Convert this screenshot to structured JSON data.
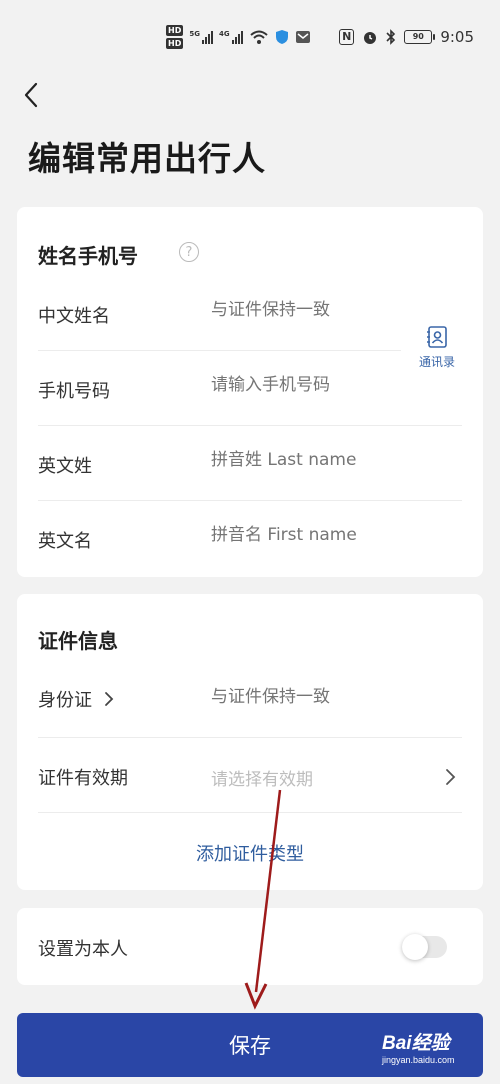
{
  "status_bar": {
    "hd1": "HD",
    "hd2": "HD",
    "sig1_label": "5G",
    "sig2_label": "4G",
    "nfc": "N",
    "battery": "90",
    "time": "9:05"
  },
  "header": {
    "title": "编辑常用出行人"
  },
  "name_section": {
    "title": "姓名手机号",
    "help": "?",
    "contacts_label": "通讯录",
    "rows": [
      {
        "label": "中文姓名",
        "placeholder": "与证件保持一致"
      },
      {
        "label": "手机号码",
        "placeholder": "请输入手机号码"
      },
      {
        "label": "英文姓",
        "placeholder": "拼音姓 Last name"
      },
      {
        "label": "英文名",
        "placeholder": "拼音名 First name"
      }
    ]
  },
  "id_section": {
    "title": "证件信息",
    "id_type_label": "身份证",
    "id_placeholder": "与证件保持一致",
    "validity_label": "证件有效期",
    "validity_placeholder": "请选择有效期",
    "add_type": "添加证件类型"
  },
  "self_section": {
    "label": "设置为本人",
    "toggle_on": false
  },
  "footer": {
    "save_label": "保存"
  },
  "watermark": {
    "logo": "Bai经验",
    "url": "jingyan.baidu.com"
  },
  "colors": {
    "accent": "#2a46a6",
    "link": "#2f5d9e",
    "annotation_arrow": "#9e1b1b"
  }
}
